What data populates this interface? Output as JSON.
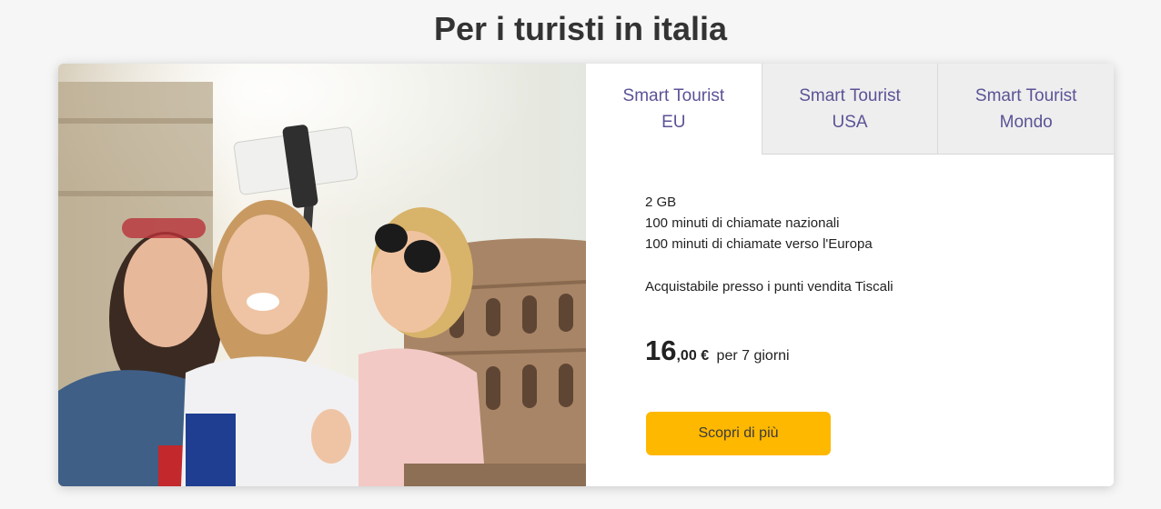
{
  "page": {
    "title": "Per i turisti in italia"
  },
  "hero_image": {
    "subject": "Three young women taking a selfie with a selfie stick in front of the Colosseum"
  },
  "tabs": [
    {
      "label": "Smart Tourist\nEU",
      "active": true
    },
    {
      "label": "Smart Tourist\nUSA",
      "active": false
    },
    {
      "label": "Smart Tourist\nMondo",
      "active": false
    }
  ],
  "offer": {
    "features": [
      "2 GB",
      "100 minuti di chiamate nazionali",
      "100 minuti di chiamate verso l'Europa"
    ],
    "availability": "Acquistabile presso i punti vendita Tiscali",
    "price": {
      "integer": "16",
      "decimal": ",00",
      "currency": "€",
      "period": "per 7 giorni"
    },
    "cta_label": "Scopri di più"
  },
  "colors": {
    "accent_button": "#ffb800",
    "tab_text": "#5a5396",
    "inactive_tab_bg": "#eeeeee"
  }
}
